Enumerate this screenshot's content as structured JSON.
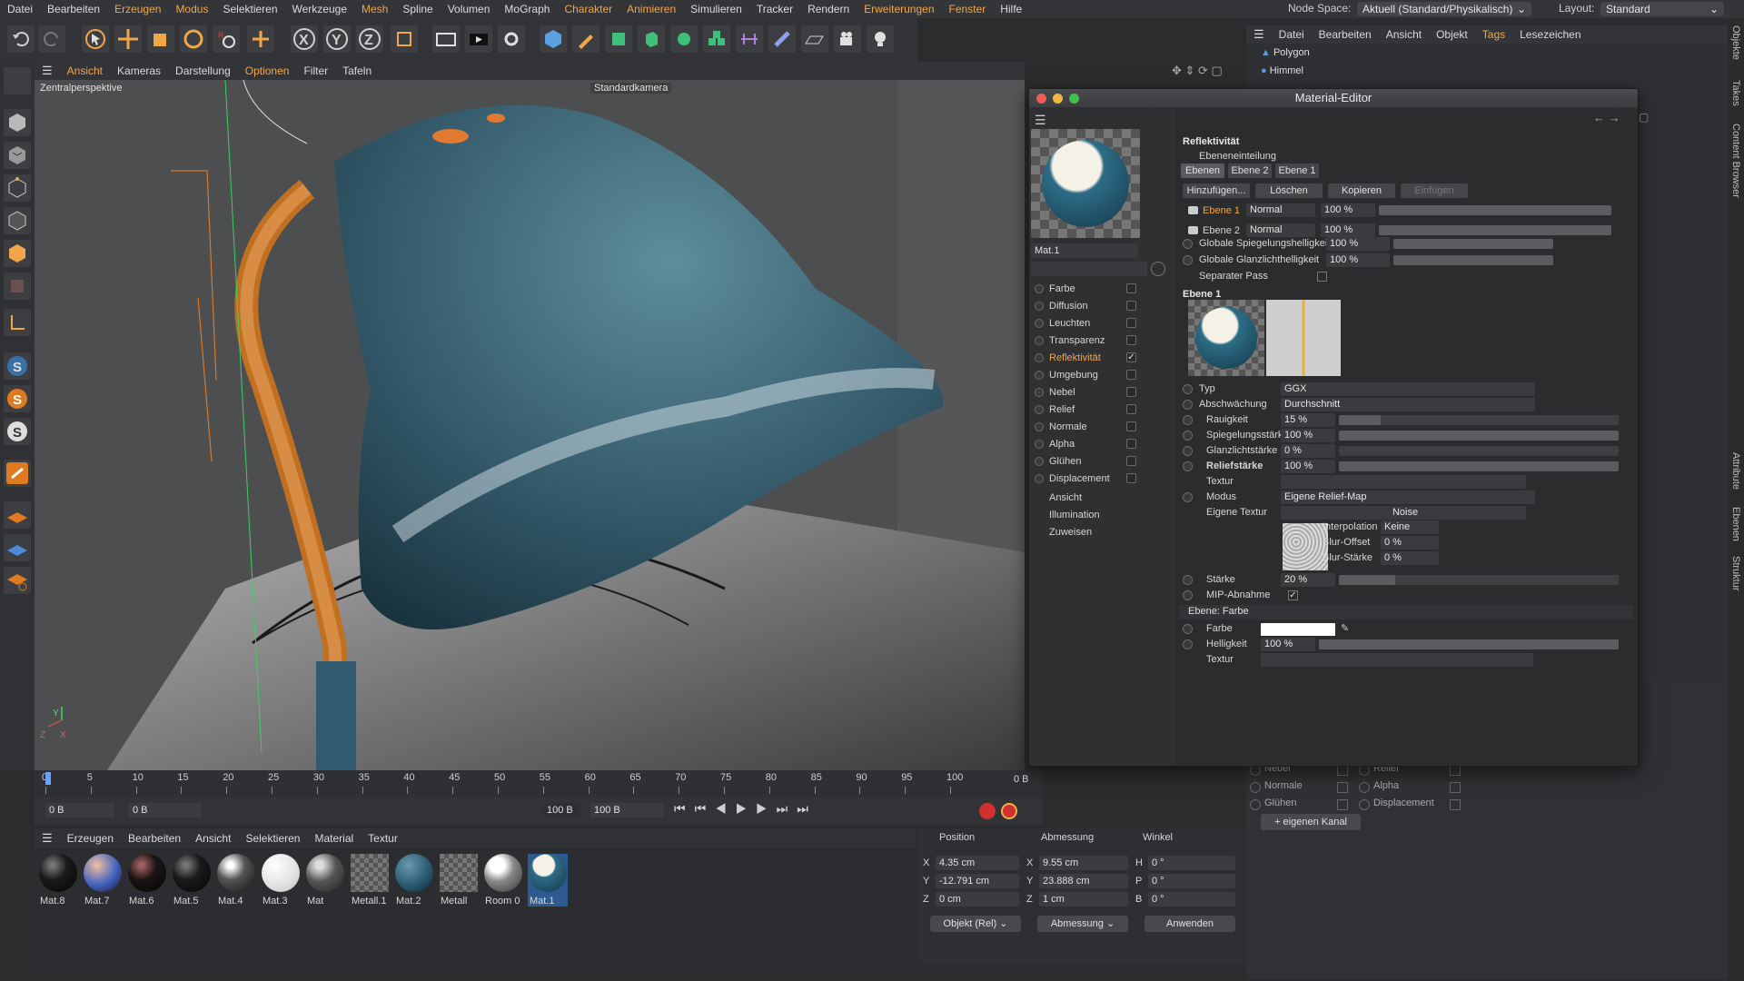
{
  "menubar": {
    "items": [
      {
        "label": "Datei",
        "hl": false
      },
      {
        "label": "Bearbeiten",
        "hl": false
      },
      {
        "label": "Erzeugen",
        "hl": true
      },
      {
        "label": "Modus",
        "hl": true
      },
      {
        "label": "Selektieren",
        "hl": false
      },
      {
        "label": "Werkzeuge",
        "hl": false
      },
      {
        "label": "Mesh",
        "hl": true
      },
      {
        "label": "Spline",
        "hl": false
      },
      {
        "label": "Volumen",
        "hl": false
      },
      {
        "label": "MoGraph",
        "hl": false
      },
      {
        "label": "Charakter",
        "hl": true
      },
      {
        "label": "Animieren",
        "hl": true
      },
      {
        "label": "Simulieren",
        "hl": false
      },
      {
        "label": "Tracker",
        "hl": false
      },
      {
        "label": "Rendern",
        "hl": false
      },
      {
        "label": "Erweiterungen",
        "hl": true
      },
      {
        "label": "Fenster",
        "hl": true
      },
      {
        "label": "Hilfe",
        "hl": false
      }
    ],
    "node_space_label": "Node Space:",
    "node_space_value": "Aktuell (Standard/Physikalisch)",
    "layout_label": "Layout:",
    "layout_value": "Standard"
  },
  "viewport": {
    "menu": [
      {
        "label": "Ansicht",
        "hl": true
      },
      {
        "label": "Kameras",
        "hl": false
      },
      {
        "label": "Darstellung",
        "hl": false
      },
      {
        "label": "Optionen",
        "hl": true
      },
      {
        "label": "Filter",
        "hl": false
      },
      {
        "label": "Tafeln",
        "hl": false
      }
    ],
    "view_name": "Zentralperspektive",
    "camera": "Standardkamera"
  },
  "objects": {
    "menu": [
      {
        "label": "Datei",
        "hl": false
      },
      {
        "label": "Bearbeiten",
        "hl": false
      },
      {
        "label": "Ansicht",
        "hl": false
      },
      {
        "label": "Objekt",
        "hl": false
      },
      {
        "label": "Tags",
        "hl": true
      },
      {
        "label": "Lesezeichen",
        "hl": false
      }
    ],
    "items": [
      "Polygon",
      "Himmel"
    ]
  },
  "right_tabs": [
    "Objekte",
    "Takes",
    "Content Browser",
    "Attribute",
    "Ebenen",
    "Struktur"
  ],
  "timeline": {
    "ticks": [
      "0",
      "5",
      "10",
      "15",
      "20",
      "25",
      "30",
      "35",
      "40",
      "45",
      "50",
      "55",
      "60",
      "65",
      "70",
      "75",
      "80",
      "85",
      "90",
      "95",
      "100"
    ],
    "end_label": "0 B",
    "start_field": "0 B",
    "cur_field": "0 B",
    "end_field": "100 B",
    "max_field": "100 B"
  },
  "materials_panel": {
    "menu": [
      "Erzeugen",
      "Bearbeiten",
      "Ansicht",
      "Selektieren",
      "Material",
      "Textur"
    ],
    "items": [
      {
        "name": "Mat.8",
        "style": "dark"
      },
      {
        "name": "Mat.7",
        "style": "color"
      },
      {
        "name": "Mat.6",
        "style": "darkred"
      },
      {
        "name": "Mat.5",
        "style": "dark"
      },
      {
        "name": "Mat.4",
        "style": "chrome"
      },
      {
        "name": "Mat.3",
        "style": "white"
      },
      {
        "name": "Mat",
        "style": "metal"
      },
      {
        "name": "Metall.1",
        "style": "grid"
      },
      {
        "name": "Mat.2",
        "style": "blue"
      },
      {
        "name": "Metall",
        "style": "grid"
      },
      {
        "name": "Room 0",
        "style": "room"
      },
      {
        "name": "Mat.1",
        "style": "teal",
        "selected": true
      }
    ]
  },
  "coords": {
    "headers": [
      "Position",
      "Abmessung",
      "Winkel"
    ],
    "rows": [
      {
        "axis": "X",
        "pos": "4.35 cm",
        "saxis": "X",
        "size": "9.55 cm",
        "raxis": "H",
        "rot": "0 °"
      },
      {
        "axis": "Y",
        "pos": "-12.791 cm",
        "saxis": "Y",
        "size": "23.888 cm",
        "raxis": "P",
        "rot": "0 °"
      },
      {
        "axis": "Z",
        "pos": "0 cm",
        "saxis": "Z",
        "size": "1 cm",
        "raxis": "B",
        "rot": "0 °"
      }
    ],
    "mode1": "Objekt (Rel)",
    "mode2": "Abmessung",
    "apply": "Anwenden"
  },
  "attr_bg": {
    "left": [
      "Nebel",
      "Normale",
      "Glühen"
    ],
    "right": [
      "Relief",
      "Alpha",
      "Displacement"
    ],
    "add_channel": "+ eigenen Kanal"
  },
  "med": {
    "title": "Material-Editor",
    "mat_name": "Mat.1",
    "channels": [
      {
        "label": "Farbe",
        "checked": false,
        "hl": false
      },
      {
        "label": "Diffusion",
        "checked": false,
        "hl": false
      },
      {
        "label": "Leuchten",
        "checked": false,
        "hl": false
      },
      {
        "label": "Transparenz",
        "checked": false,
        "hl": false
      },
      {
        "label": "Reflektivität",
        "checked": true,
        "hl": true
      },
      {
        "label": "Umgebung",
        "checked": false,
        "hl": false
      },
      {
        "label": "Nebel",
        "checked": false,
        "hl": false
      },
      {
        "label": "Relief",
        "checked": false,
        "hl": false
      },
      {
        "label": "Normale",
        "checked": false,
        "hl": false
      },
      {
        "label": "Alpha",
        "checked": false,
        "hl": false
      },
      {
        "label": "Glühen",
        "checked": false,
        "hl": false
      },
      {
        "label": "Displacement",
        "checked": false,
        "hl": false
      }
    ],
    "extra": [
      "Ansicht",
      "Illumination",
      "Zuweisen"
    ],
    "section": "Reflektivität",
    "layer_division": "Ebeneneinteilung",
    "layer_tabs": [
      "Ebenen",
      "Ebene 2",
      "Ebene 1"
    ],
    "layer_buttons": [
      "Hinzufügen...",
      "Löschen",
      "Kopieren",
      "Einfügen"
    ],
    "layers": [
      {
        "name": "Ebene 1",
        "mode": "Normal",
        "value": "100 %",
        "active": true
      },
      {
        "name": "Ebene 2",
        "mode": "Normal",
        "value": "100 %",
        "active": false
      }
    ],
    "global_spec": {
      "label": "Globale Spiegelungshelligkeit",
      "value": "100 %"
    },
    "global_gloss": {
      "label": "Globale Glanzlichthelligkeit",
      "value": "100 %"
    },
    "separate_pass": "Separater Pass",
    "layer_title": "Ebene 1",
    "type": {
      "label": "Typ",
      "value": "GGX"
    },
    "attenuation": {
      "label": "Abschwächung",
      "value": "Durchschnitt"
    },
    "roughness": {
      "label": "Rauigkeit",
      "value": "15 %",
      "fill": 0.15
    },
    "spec_strength": {
      "label": "Spiegelungsstärke",
      "value": "100 %",
      "fill": 1.0
    },
    "gloss_strength": {
      "label": "Glanzlichtstärke",
      "value": "0 %",
      "fill": 0.0
    },
    "bump_strength": {
      "label": "Reliefstärke",
      "value": "100 %",
      "fill": 1.0
    },
    "texture_label": "Textur",
    "mode": {
      "label": "Modus",
      "value": "Eigene Relief-Map"
    },
    "custom_texture": {
      "label": "Eigene Textur",
      "value": "Noise"
    },
    "interp": {
      "label": "Interpolation",
      "value": "Keine"
    },
    "blur_offset": {
      "label": "Blur-Offset",
      "value": "0 %"
    },
    "blur_strength": {
      "label": "Blur-Stärke",
      "value": "0 %"
    },
    "strength": {
      "label": "Stärke",
      "value": "20 %",
      "fill": 0.2
    },
    "mip": "MIP-Abnahme",
    "layer_color_title": "Ebene: Farbe",
    "color_label": "Farbe",
    "brightness": {
      "label": "Helligkeit",
      "value": "100 %",
      "fill": 1.0
    },
    "texture2": "Textur"
  },
  "colors": {
    "accent": "#f2a64a",
    "panel": "#2e2f31",
    "field": "#3a3b3e"
  }
}
